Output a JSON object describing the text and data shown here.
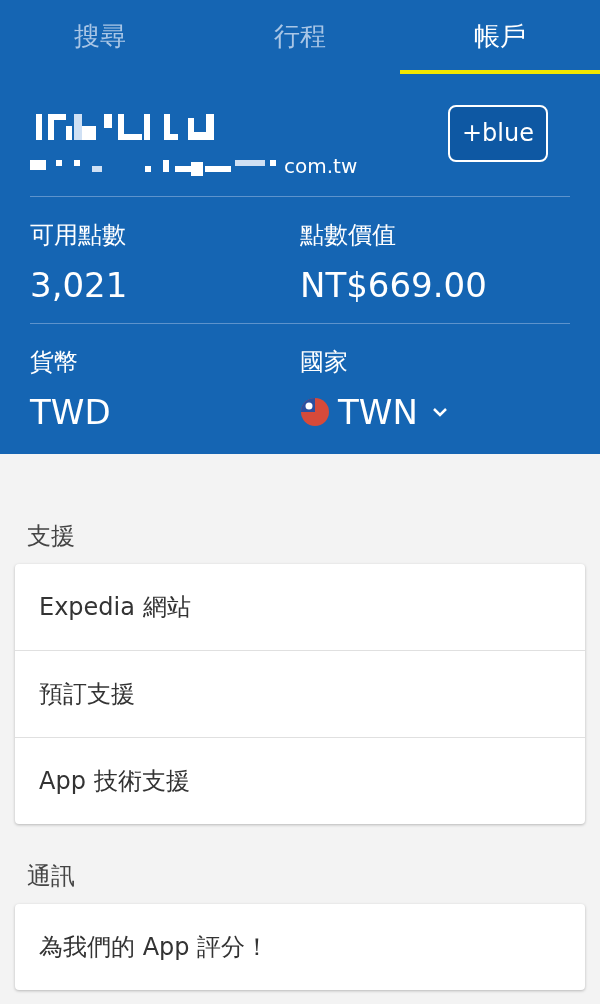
{
  "tabs": [
    {
      "label": "搜尋",
      "selected": false
    },
    {
      "label": "行程",
      "selected": false
    },
    {
      "label": "帳戶",
      "selected": true
    }
  ],
  "account": {
    "email_visible": "com.tw",
    "plan_button": "+blue"
  },
  "stats": [
    {
      "label": "可用點數",
      "value": "3,021"
    },
    {
      "label": "點數價值",
      "value": "NT$669.00"
    },
    {
      "label": "貨幣",
      "value": "TWD"
    },
    {
      "label": "國家",
      "value": "TWN",
      "kind": "country"
    }
  ],
  "sections": [
    {
      "title": "支援",
      "items": [
        "Expedia 網站",
        "預訂支援",
        "App 技術支援"
      ]
    },
    {
      "title": "通訊",
      "items": [
        "為我們的 App 評分！"
      ]
    }
  ]
}
